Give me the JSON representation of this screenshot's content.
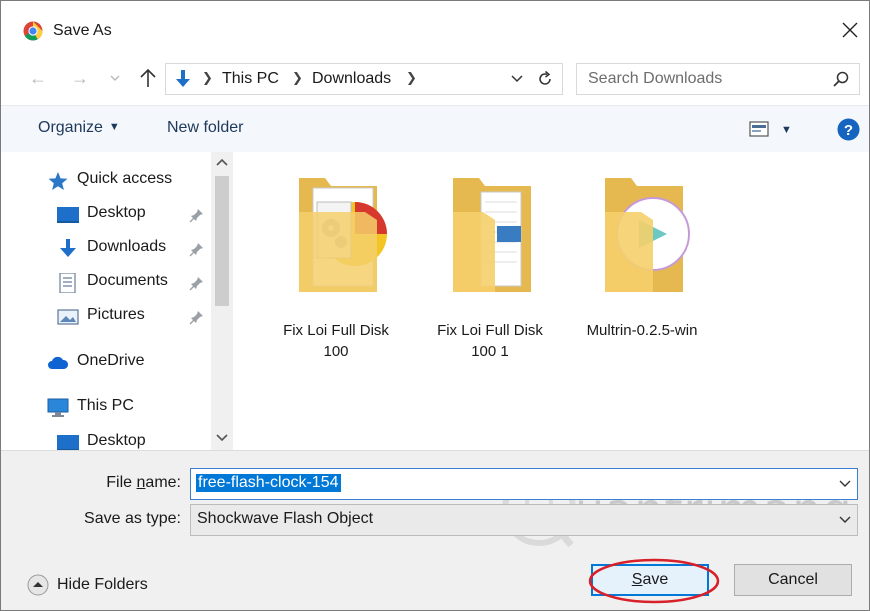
{
  "window": {
    "title": "Save As",
    "icon": "chrome-icon",
    "accent": "#0078d7"
  },
  "address": {
    "crumbs": [
      "This PC",
      "Downloads"
    ],
    "search_placeholder": "Search Downloads"
  },
  "toolbar": {
    "organize_label": "Organize",
    "new_folder_label": "New folder"
  },
  "nav": {
    "items": [
      {
        "label": "Quick access",
        "icon": "star-icon"
      },
      {
        "label": "Desktop",
        "icon": "desktop-icon",
        "pinned": true
      },
      {
        "label": "Downloads",
        "icon": "download-arrow-icon",
        "pinned": true
      },
      {
        "label": "Documents",
        "icon": "document-icon",
        "pinned": true
      },
      {
        "label": "Pictures",
        "icon": "pictures-icon",
        "pinned": true
      },
      {
        "label": "OneDrive",
        "icon": "cloud-icon"
      },
      {
        "label": "This PC",
        "icon": "computer-icon"
      },
      {
        "label": "Desktop",
        "icon": "desktop-icon"
      }
    ]
  },
  "files": [
    {
      "line1": "Fix Loi Full Disk",
      "line2": "100"
    },
    {
      "line1": "Fix Loi Full Disk",
      "line2": "100 1"
    },
    {
      "line1": "Multrin-0.2.5-win",
      "line2": ""
    }
  ],
  "form": {
    "file_name_label_pre": "File ",
    "file_name_label_key": "n",
    "file_name_label_post": "ame:",
    "file_name_value": "free-flash-clock-154",
    "save_type_label": "Save as type:",
    "save_type_value": "Shockwave Flash Object"
  },
  "buttons": {
    "hide_folders": "Hide Folders",
    "save_key": "S",
    "save_rest": "ave",
    "cancel": "Cancel"
  },
  "watermark": {
    "text": "uantrimang"
  }
}
